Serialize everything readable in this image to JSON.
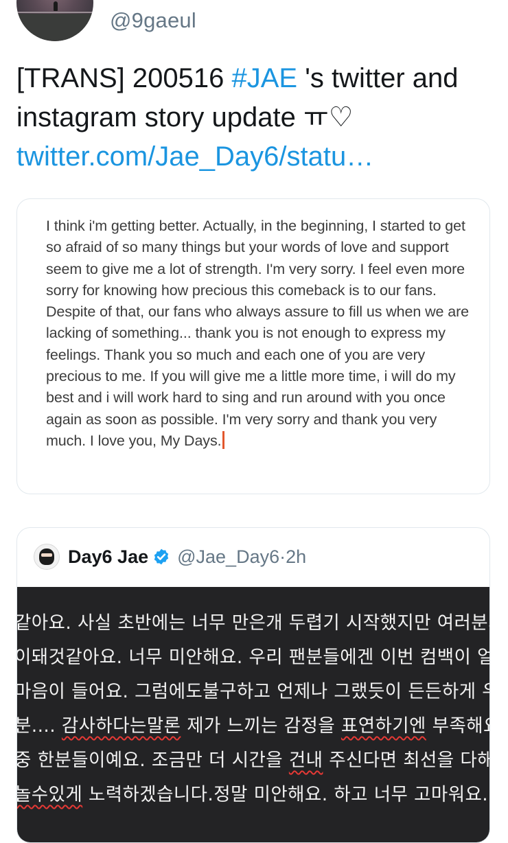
{
  "author": {
    "handle": "@9gaeul"
  },
  "tweet": {
    "text_before": "[TRANS] 200516 ",
    "hashtag": "#JAE",
    "text_after": " 's twitter and instagram story update ㅠ♡",
    "link": "twitter.com/Jae_Day6/statu…"
  },
  "note": {
    "text": "I think i'm getting better. Actually, in the beginning, I started to get so afraid of so many things but your words of love and support seem to give me a lot of strength. I'm very sorry. I feel even more sorry for knowing how precious this comeback is to our fans. Despite of that, our fans who always assure to fill us when we are lacking of something... thank you is not enough to express my feelings. Thank you so much and each one of you are very precious to me. If you will give me a little more time, i will do my best and i will work hard to sing and run around with you once again as soon as possible. I'm very sorry and thank you very much. I love you, My Days."
  },
  "quoted": {
    "name": "Day6 Jae",
    "handle": "@Jae_Day6",
    "separator": " · ",
    "time": "2h",
    "image_lines": {
      "l1": "같아요. 사실 초반에는 너무 만은개 두렵기 시작했지만 여러분의",
      "l2": "이돼것같아요. 너무 미안해요. 우리 팬분들에겐 이번 컴백이 얼마",
      "l3": "마음이 들어요. 그럼에도불구하고 언제나 그랬듯이 든든하게 우리",
      "l4a": "분.... ",
      "l4b": "감사하다는말론",
      "l4c": " 제가 느끼는 감정을 ",
      "l4d": "표연하기엔",
      "l4e": " 부족해요",
      "l5a": "중 한분들이예요. 조금만 더 시간을 ",
      "l5b": "건내",
      "l5c": " 주신다면 최선을 다해",
      "l6a": "놀수있게",
      "l6b": " 노력하겠습니다.정말 미안해요. 하고 너무 고마워요."
    }
  },
  "colors": {
    "link": "#1b95e0",
    "caret": "#e2572d",
    "image_bg": "#232325"
  }
}
